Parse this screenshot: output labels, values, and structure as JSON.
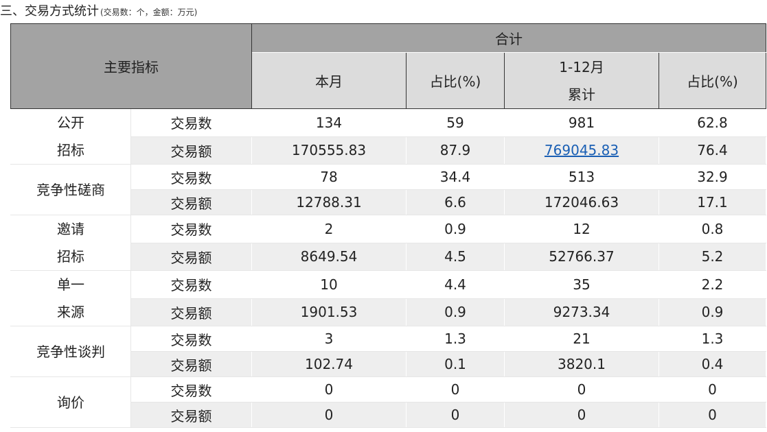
{
  "heading": {
    "title": "三、交易方式统计",
    "note": "(交易数：个，金额：万元)"
  },
  "header": {
    "main_indicator": "主要指标",
    "total": "合计",
    "this_month": "本月",
    "share1": "占比(%)",
    "cumulative_line1": "1-12月",
    "cumulative_line2": "累计",
    "share2": "占比(%)"
  },
  "groups": [
    {
      "name_lines": [
        "公开",
        "招标"
      ],
      "rows": [
        {
          "metric": "交易数",
          "month": "134",
          "share_month": "59",
          "cumulative": "981",
          "share_cum": "62.8",
          "cum_is_link": false
        },
        {
          "metric": "交易额",
          "month": "170555.83",
          "share_month": "87.9",
          "cumulative": "769045.83",
          "share_cum": "76.4",
          "cum_is_link": true
        }
      ]
    },
    {
      "name_lines": [
        "竞争性磋商"
      ],
      "rows": [
        {
          "metric": "交易数",
          "month": "78",
          "share_month": "34.4",
          "cumulative": "513",
          "share_cum": "32.9",
          "cum_is_link": false
        },
        {
          "metric": "交易额",
          "month": "12788.31",
          "share_month": "6.6",
          "cumulative": "172046.63",
          "share_cum": "17.1",
          "cum_is_link": false
        }
      ]
    },
    {
      "name_lines": [
        "邀请",
        "招标"
      ],
      "rows": [
        {
          "metric": "交易数",
          "month": "2",
          "share_month": "0.9",
          "cumulative": "12",
          "share_cum": "0.8",
          "cum_is_link": false
        },
        {
          "metric": "交易额",
          "month": "8649.54",
          "share_month": "4.5",
          "cumulative": "52766.37",
          "share_cum": "5.2",
          "cum_is_link": false
        }
      ]
    },
    {
      "name_lines": [
        "单一",
        "来源"
      ],
      "rows": [
        {
          "metric": "交易数",
          "month": "10",
          "share_month": "4.4",
          "cumulative": "35",
          "share_cum": "2.2",
          "cum_is_link": false
        },
        {
          "metric": "交易额",
          "month": "1901.53",
          "share_month": "0.9",
          "cumulative": "9273.34",
          "share_cum": "0.9",
          "cum_is_link": false
        }
      ]
    },
    {
      "name_lines": [
        "竞争性谈判"
      ],
      "rows": [
        {
          "metric": "交易数",
          "month": "3",
          "share_month": "1.3",
          "cumulative": "21",
          "share_cum": "1.3",
          "cum_is_link": false
        },
        {
          "metric": "交易额",
          "month": "102.74",
          "share_month": "0.1",
          "cumulative": "3820.1",
          "share_cum": "0.4",
          "cum_is_link": false
        }
      ]
    },
    {
      "name_lines": [
        "询价"
      ],
      "rows": [
        {
          "metric": "交易数",
          "month": "0",
          "share_month": "0",
          "cumulative": "0",
          "share_cum": "0",
          "cum_is_link": false
        },
        {
          "metric": "交易额",
          "month": "0",
          "share_month": "0",
          "cumulative": "0",
          "share_cum": "0",
          "cum_is_link": false
        }
      ]
    }
  ],
  "colors": {
    "header_dark": "#a3a3a3",
    "header_light": "#dcdcdc",
    "row_shade": "#eeeeee",
    "link": "#1a5fb4"
  }
}
